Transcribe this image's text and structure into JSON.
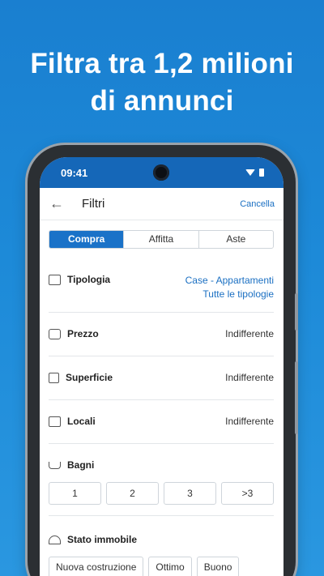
{
  "headline": {
    "line1": "Filtra tra 1,2 milioni",
    "line2": "di annunci"
  },
  "status": {
    "time": "09:41"
  },
  "appbar": {
    "back_icon": "arrow-left-icon",
    "title": "Filtri",
    "cancel": "Cancella"
  },
  "tabs": [
    {
      "label": "Compra",
      "active": true
    },
    {
      "label": "Affitta",
      "active": false
    },
    {
      "label": "Aste",
      "active": false
    }
  ],
  "filters": {
    "tipologia": {
      "label": "Tipologia",
      "icon": "building-icon",
      "value1": "Case - Appartamenti",
      "value2": "Tutte le tipologie"
    },
    "prezzo": {
      "label": "Prezzo",
      "icon": "money-icon",
      "value": "Indifferente"
    },
    "superficie": {
      "label": "Superficie",
      "icon": "area-icon",
      "value": "Indifferente"
    },
    "locali": {
      "label": "Locali",
      "icon": "room-icon",
      "value": "Indifferente"
    },
    "bagni": {
      "label": "Bagni",
      "icon": "bathtub-icon",
      "options": [
        "1",
        "2",
        "3",
        ">3"
      ]
    },
    "stato": {
      "label": "Stato immobile",
      "icon": "helmet-icon",
      "options": [
        "Nuova costruzione",
        "Ottimo",
        "Buono"
      ]
    }
  },
  "colors": {
    "brand_blue": "#1a72c8",
    "link": "#1a6fc2"
  }
}
